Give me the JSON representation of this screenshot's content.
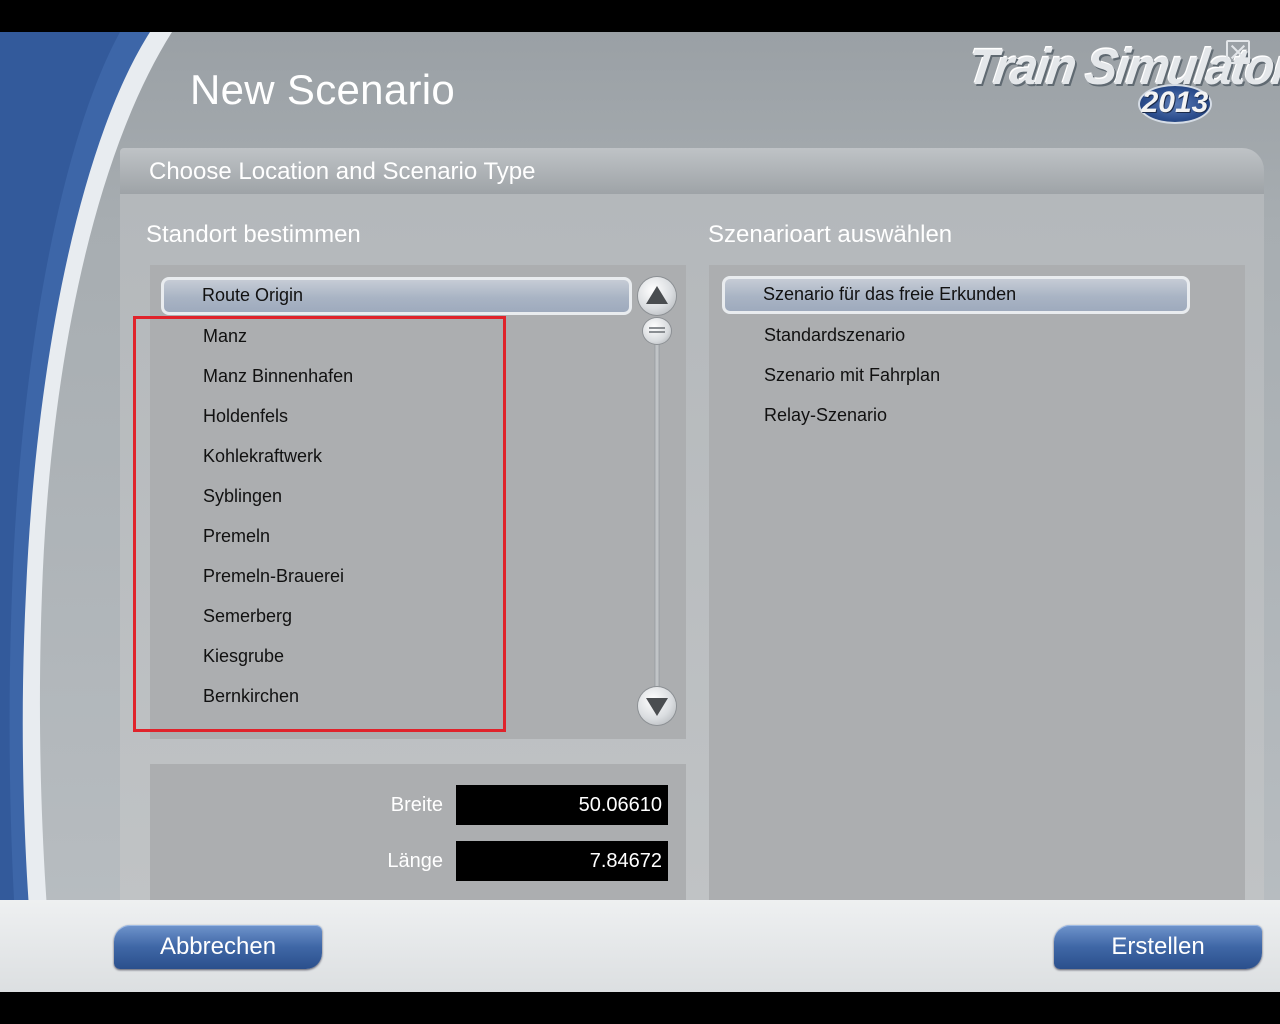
{
  "window": {
    "title": "New Scenario",
    "brand": {
      "name": "Train Simulator",
      "year": "2013"
    },
    "close_icon": "close-icon"
  },
  "section": {
    "title": "Choose Location and Scenario Type"
  },
  "location": {
    "heading": "Standort bestimmen",
    "selected": "Route Origin",
    "items": [
      "Route Origin",
      "Manz",
      "Manz Binnenhafen",
      "Holdenfels",
      "Kohlekraftwerk",
      "Syblingen",
      "Premeln",
      "Premeln-Brauerei",
      "Semerberg",
      "Kiesgrube",
      "Bernkirchen"
    ],
    "scroll_up_icon": "triangle-up-icon",
    "scroll_down_icon": "triangle-down-icon"
  },
  "scenario_type": {
    "heading": "Szenarioart auswählen",
    "selected": "Szenario für das freie Erkunden",
    "items": [
      "Szenario für das freie Erkunden",
      "Standardszenario",
      "Szenario mit Fahrplan",
      "Relay-Szenario"
    ]
  },
  "coordinates": {
    "latitude_label": "Breite",
    "latitude_value": "50.06610",
    "longitude_label": "Länge",
    "longitude_value": "7.84672"
  },
  "footer": {
    "cancel_label": "Abbrechen",
    "create_label": "Erstellen"
  },
  "colors": {
    "accent_blue": "#3f67a6",
    "highlight_red": "#e0232b",
    "selection_fill": "#a9b4c4"
  }
}
